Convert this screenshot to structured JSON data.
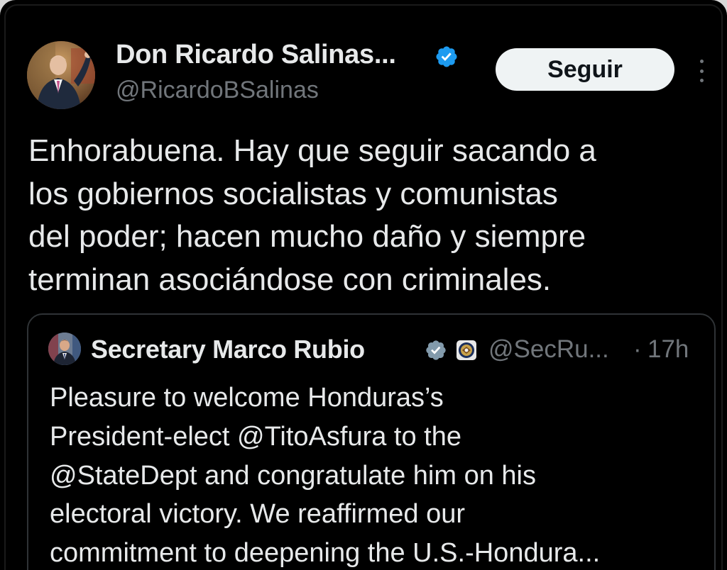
{
  "tweet": {
    "author": {
      "name": "Don Ricardo Salinas...",
      "handle": "@RicardoBSalinas",
      "verified": true,
      "avatar": "avatar-photo"
    },
    "follow_label": "Seguir",
    "more_icon": "more-vertical-icon",
    "text_lines": [
      "Enhorabuena. Hay que seguir sacando a",
      "los gobiernos socialistas y comunistas",
      "del poder; hacen mucho daño y siempre",
      "terminan asociándose con criminales."
    ]
  },
  "quoted_tweet": {
    "author": {
      "name": "Secretary Marco Rubio",
      "handle": "@SecRu...",
      "verified": true,
      "affiliation_badge": "state-department-seal-icon"
    },
    "separator": "·",
    "time": "17h",
    "text_lines": [
      "Pleasure to welcome Honduras’s",
      "President-elect @TitoAsfura to the",
      "@StateDept and congratulate him on his",
      "electoral victory. We reaffirmed our",
      "commitment to deepening the U.S.-Hondura..."
    ]
  },
  "colors": {
    "background": "#000000",
    "text_primary": "#e7e9ea",
    "text_secondary": "#71767b",
    "verified_blue": "#1d9bf0",
    "button_bg": "#eff3f4",
    "border": "#2f3336"
  }
}
